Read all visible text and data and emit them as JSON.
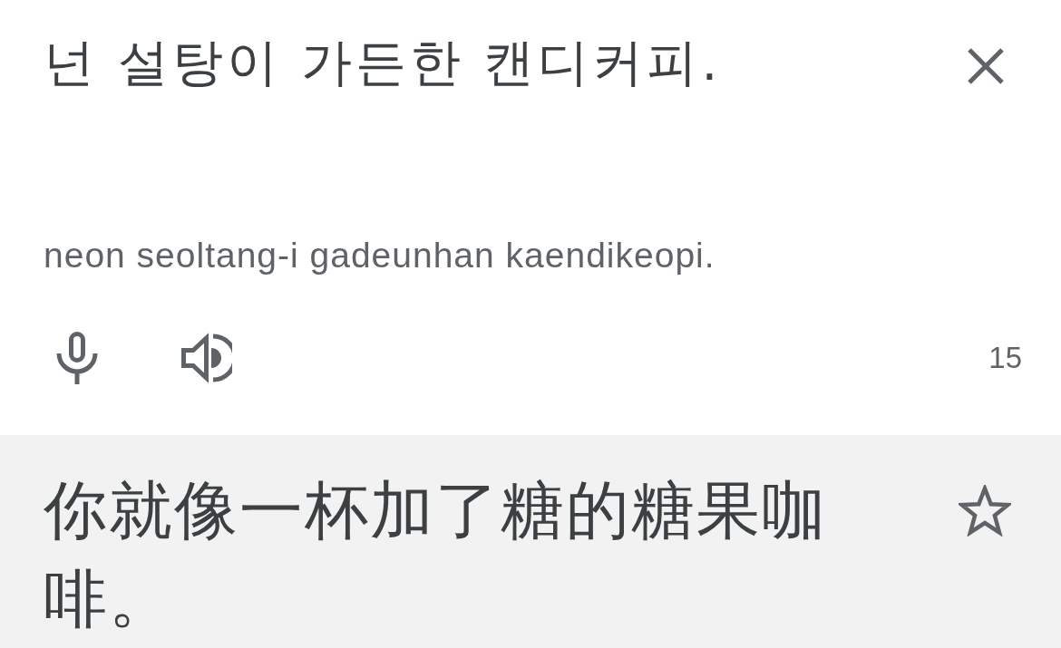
{
  "source": {
    "text": "넌 설탕이 가든한 캔디커피.",
    "romanization": "neon seoltang-i gadeunhan kaendikeopi.",
    "character_count": "15"
  },
  "translation": {
    "text": "你就像一杯加了糖的糖果咖啡。",
    "starred": false
  }
}
